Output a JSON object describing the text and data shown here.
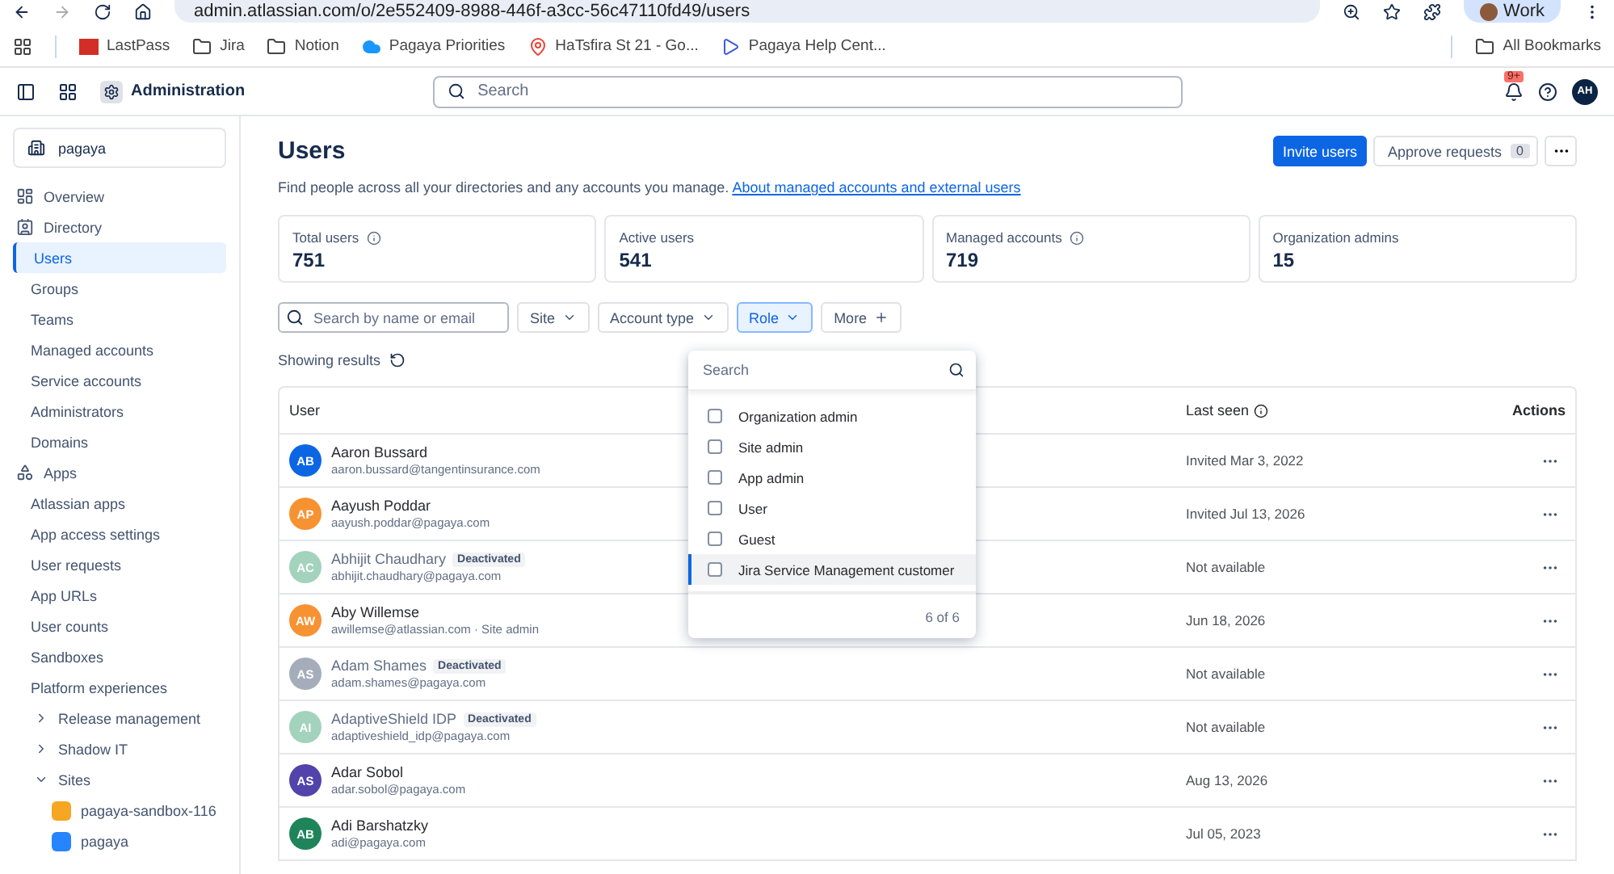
{
  "browser": {
    "url": "admin.atlassian.com/o/2e552409-8988-446f-a3cc-56c47110fd49/users",
    "profile": "Work",
    "bookmarks": [
      {
        "kind": "lastpass",
        "label": "LastPass"
      },
      {
        "kind": "folder",
        "label": "Jira"
      },
      {
        "kind": "folder",
        "label": "Notion"
      },
      {
        "kind": "cloud",
        "label": "Pagaya Priorities"
      },
      {
        "kind": "pin",
        "label": "HaTsfira St 21 - Go..."
      },
      {
        "kind": "play",
        "label": "Pagaya Help Cent..."
      }
    ],
    "all_bookmarks": "All Bookmarks"
  },
  "header": {
    "product": "Administration",
    "search": {
      "placeholder": "Search"
    },
    "notifications": "9+",
    "avatar": "AH"
  },
  "sidebar": {
    "org": "pagaya",
    "items": [
      {
        "kind": "section",
        "label": "Overview",
        "selected": false
      },
      {
        "kind": "section",
        "label": "Directory",
        "selected": false
      },
      {
        "kind": "link",
        "label": "Users",
        "selected": true
      },
      {
        "kind": "link",
        "label": "Groups",
        "selected": false
      },
      {
        "kind": "link",
        "label": "Teams",
        "selected": false
      },
      {
        "kind": "link",
        "label": "Managed accounts",
        "selected": false
      },
      {
        "kind": "link",
        "label": "Service accounts",
        "selected": false
      },
      {
        "kind": "link",
        "label": "Administrators",
        "selected": false
      },
      {
        "kind": "link",
        "label": "Domains",
        "selected": false
      },
      {
        "kind": "section",
        "label": "Apps",
        "selected": false
      },
      {
        "kind": "link",
        "label": "Atlassian apps",
        "selected": false
      },
      {
        "kind": "link",
        "label": "App access settings",
        "selected": false
      },
      {
        "kind": "link",
        "label": "User requests",
        "selected": false
      },
      {
        "kind": "link",
        "label": "App URLs",
        "selected": false
      },
      {
        "kind": "link",
        "label": "User counts",
        "selected": false
      },
      {
        "kind": "link",
        "label": "Sandboxes",
        "selected": false
      },
      {
        "kind": "link",
        "label": "Platform experiences",
        "selected": false
      },
      {
        "kind": "group",
        "label": "Release management",
        "expanded": false,
        "selected": false
      },
      {
        "kind": "group",
        "label": "Shadow IT",
        "expanded": false,
        "selected": false
      },
      {
        "kind": "group",
        "label": "Sites",
        "expanded": true,
        "selected": false,
        "children": [
          {
            "label": "pagaya-sandbox-116",
            "color": "#f5a623",
            "selected": false
          },
          {
            "label": "pagaya",
            "color": "#2684ff",
            "selected": false
          }
        ]
      }
    ]
  },
  "page": {
    "title": "Users",
    "invite": "Invite users",
    "approve": "Approve requests",
    "approve_count": "0",
    "description": "Find people across all your directories and any accounts you manage.",
    "link": "About managed accounts and external users",
    "stats": [
      {
        "label": "Total users",
        "value": "751",
        "info": true
      },
      {
        "label": "Active users",
        "value": "541",
        "info": false
      },
      {
        "label": "Managed accounts",
        "value": "719",
        "info": true
      },
      {
        "label": "Organization admins",
        "value": "15",
        "info": false
      }
    ],
    "filters": {
      "search": {
        "placeholder": "Search by name or email"
      },
      "buttons": [
        {
          "label": "Site",
          "kind": "dropdown",
          "selected": false
        },
        {
          "label": "Account type",
          "kind": "dropdown",
          "selected": false
        },
        {
          "label": "Role",
          "kind": "dropdown",
          "selected": true
        },
        {
          "label": "More",
          "kind": "add",
          "selected": false
        }
      ]
    },
    "showing": "Showing results",
    "table": {
      "columns": [
        "User",
        "Last seen",
        "Actions"
      ],
      "rows": [
        {
          "initials": "AB",
          "color": "#0c66e4",
          "name": "Aaron Bussard",
          "email": "aaron.bussard@tangentinsurance.com",
          "deactivated": false,
          "last_seen": "Invited Mar 3, 2022"
        },
        {
          "initials": "AP",
          "color": "#f79232",
          "name": "Aayush Poddar",
          "email": "aayush.poddar@pagaya.com",
          "deactivated": false,
          "last_seen": "Invited Jul 13, 2026"
        },
        {
          "initials": "AC",
          "color": "#a3d2bd",
          "name": "Abhijit Chaudhary",
          "email": "abhijit.chaudhary@pagaya.com",
          "deactivated": true,
          "badge": "Deactivated",
          "last_seen": "Not available"
        },
        {
          "initials": "AW",
          "color": "#f79232",
          "name": "Aby Willemse",
          "email": "awillemse@atlassian.com · Site admin",
          "deactivated": false,
          "last_seen": "Jun 18, 2026"
        },
        {
          "initials": "AS",
          "color": "#a5adba",
          "name": "Adam Shames",
          "email": "adam.shames@pagaya.com",
          "deactivated": true,
          "badge": "Deactivated",
          "last_seen": "Not available"
        },
        {
          "initials": "AI",
          "color": "#a3d2bd",
          "name": "AdaptiveShield IDP",
          "email": "adaptiveshield_idp@pagaya.com",
          "deactivated": true,
          "badge": "Deactivated",
          "last_seen": "Not available"
        },
        {
          "initials": "AS",
          "color": "#5243aa",
          "name": "Adar Sobol",
          "email": "adar.sobol@pagaya.com",
          "deactivated": false,
          "last_seen": "Aug 13, 2026"
        },
        {
          "initials": "AB",
          "color": "#1f845a",
          "name": "Adi Barshatzky",
          "email": "adi@pagaya.com",
          "deactivated": false,
          "last_seen": "Jul 05, 2023"
        }
      ]
    },
    "role_menu": {
      "search": {
        "placeholder": "Search"
      },
      "options": [
        {
          "label": "Organization admin",
          "checked": false,
          "focused": false
        },
        {
          "label": "Site admin",
          "checked": false,
          "focused": false
        },
        {
          "label": "App admin",
          "checked": false,
          "focused": false
        },
        {
          "label": "User",
          "checked": false,
          "focused": false
        },
        {
          "label": "Guest",
          "checked": false,
          "focused": false
        },
        {
          "label": "Jira Service Management customer",
          "checked": false,
          "focused": true
        }
      ],
      "count": "6 of 6"
    }
  }
}
